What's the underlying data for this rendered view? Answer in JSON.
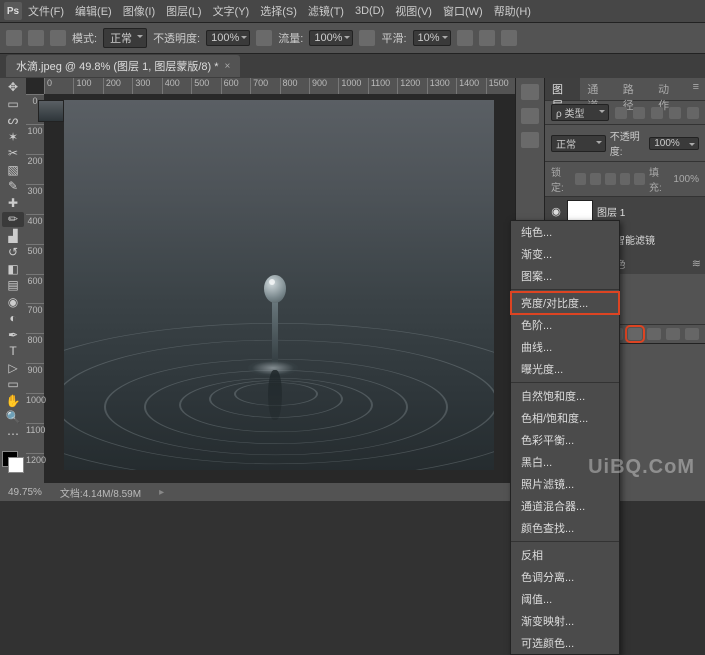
{
  "menubar": {
    "logo": "Ps",
    "items": [
      "文件(F)",
      "编辑(E)",
      "图像(I)",
      "图层(L)",
      "文字(Y)",
      "选择(S)",
      "滤镜(T)",
      "3D(D)",
      "视图(V)",
      "窗口(W)",
      "帮助(H)"
    ]
  },
  "options": {
    "mode_label": "模式:",
    "mode_value": "正常",
    "opacity_label": "不透明度:",
    "opacity_value": "100%",
    "flow_label": "流量:",
    "flow_value": "100%",
    "smooth_label": "平滑:",
    "smooth_value": "10%"
  },
  "tab": {
    "title": "水滴.jpeg @ 49.8% (图层 1, 图层蒙版/8) *"
  },
  "ruler_h": [
    "0",
    "100",
    "200",
    "300",
    "400",
    "500",
    "600",
    "700",
    "800",
    "900",
    "1000",
    "1100",
    "1200",
    "1300",
    "1400",
    "1500"
  ],
  "ruler_v": [
    "0",
    "100",
    "200",
    "300",
    "400",
    "500",
    "600",
    "700",
    "800",
    "900",
    "1000",
    "1100",
    "1200"
  ],
  "panels": {
    "tabs": [
      "图层",
      "通道",
      "路径",
      "动作"
    ],
    "filter_label": "类型",
    "filter_value": "ρ 类型",
    "blend_value": "正常",
    "opacity_label": "不透明度:",
    "opacity_value": "100%",
    "lock_label": "锁定:",
    "fill_label": "填充:",
    "fill_value": "100%",
    "layers": [
      {
        "name": "图层 1",
        "visible": true,
        "hasMask": true
      },
      {
        "name": "智能滤镜",
        "visible": true,
        "indent": true,
        "italic": false,
        "maskOnly": true
      },
      {
        "name": "减少杂色",
        "visible": true,
        "indent": true,
        "italic": true,
        "textOnly": true
      }
    ]
  },
  "context_menu": {
    "groups": [
      [
        "纯色...",
        "渐变...",
        "图案..."
      ],
      [
        "亮度/对比度...",
        "色阶...",
        "曲线...",
        "曝光度..."
      ],
      [
        "自然饱和度...",
        "色相/饱和度...",
        "色彩平衡...",
        "黑白...",
        "照片滤镜...",
        "通道混合器...",
        "颜色查找..."
      ],
      [
        "反相",
        "色调分离...",
        "阈值...",
        "渐变映射...",
        "可选颜色..."
      ]
    ],
    "highlighted": "亮度/对比度..."
  },
  "statusbar": {
    "zoom": "49.75%",
    "doc_label": "文档:",
    "doc_value": "4.14M/8.59M"
  },
  "watermark": "UiBQ.CoM"
}
